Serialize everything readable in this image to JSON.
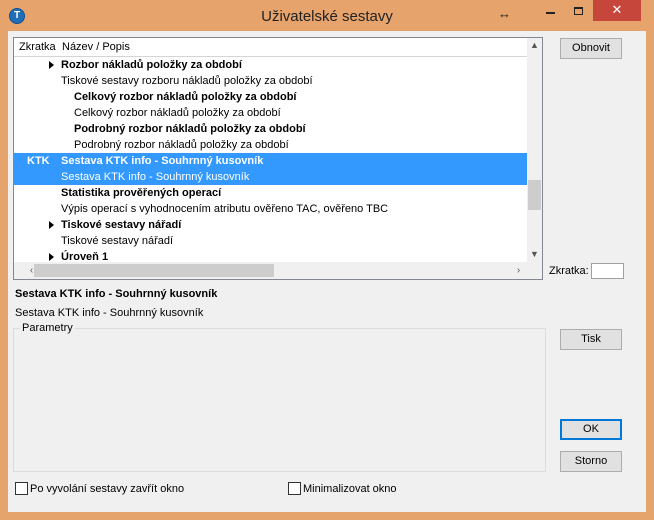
{
  "window": {
    "title": "Uživatelské sestavy",
    "icon": "app-logo-icon",
    "resize_icon": "↔",
    "close_glyph": "✕"
  },
  "list": {
    "columns": [
      "Zkratka",
      "Název / Popis"
    ],
    "rows": [
      {
        "code": "",
        "text": "Rozbor nákladů položky za období",
        "bold": true,
        "indent": 1,
        "arrow": true,
        "selected": false
      },
      {
        "code": "",
        "text": "Tiskové sestavy rozboru nákladů položky za období",
        "bold": false,
        "indent": 1,
        "arrow": false,
        "selected": false
      },
      {
        "code": "",
        "text": "Celkový rozbor nákladů položky za období",
        "bold": true,
        "indent": 2,
        "arrow": false,
        "selected": false
      },
      {
        "code": "",
        "text": "Celkový rozbor nákladů položky za období",
        "bold": false,
        "indent": 2,
        "arrow": false,
        "selected": false
      },
      {
        "code": "",
        "text": "Podrobný rozbor nákladů položky za období",
        "bold": true,
        "indent": 2,
        "arrow": false,
        "selected": false
      },
      {
        "code": "",
        "text": "Podrobný rozbor nákladů položky za období",
        "bold": false,
        "indent": 2,
        "arrow": false,
        "selected": false
      },
      {
        "code": "KTK",
        "text": "Sestava KTK info - Souhrnný kusovník",
        "bold": true,
        "indent": 1,
        "arrow": false,
        "selected": true
      },
      {
        "code": "",
        "text": "Sestava KTK info - Souhrnný kusovník",
        "bold": false,
        "indent": 1,
        "arrow": false,
        "selected": true
      },
      {
        "code": "",
        "text": "Statistika prověřených operací",
        "bold": true,
        "indent": 1,
        "arrow": false,
        "selected": false
      },
      {
        "code": "",
        "text": "Výpis operací s vyhodnocením atributu ověřeno TAC, ověřeno TBC",
        "bold": false,
        "indent": 1,
        "arrow": false,
        "selected": false
      },
      {
        "code": "",
        "text": "Tiskové sestavy nářadí",
        "bold": true,
        "indent": 1,
        "arrow": true,
        "selected": false
      },
      {
        "code": "",
        "text": "Tiskové sestavy nářadí",
        "bold": false,
        "indent": 1,
        "arrow": false,
        "selected": false
      },
      {
        "code": "",
        "text": "Úroveň 1",
        "bold": true,
        "indent": 1,
        "arrow": true,
        "selected": false
      }
    ]
  },
  "buttons": {
    "refresh": "Obnovit",
    "print": "Tisk",
    "ok": "OK",
    "cancel": "Storno"
  },
  "shortcut": {
    "label": "Zkratka:",
    "value": ""
  },
  "selected_info": {
    "title": "Sestava KTK info - Souhrnný kusovník",
    "description": "Sestava KTK info - Souhrnný kusovník"
  },
  "parameters": {
    "title": "Parametry"
  },
  "options": {
    "close_after": "Po vyvolání sestavy zavřít okno",
    "close_after_checked": false,
    "minimize": "Minimalizovat okno",
    "minimize_checked": false
  },
  "colors": {
    "titlebar": "#e6a36b",
    "selection": "#3399ff",
    "close_button": "#c7463b"
  }
}
